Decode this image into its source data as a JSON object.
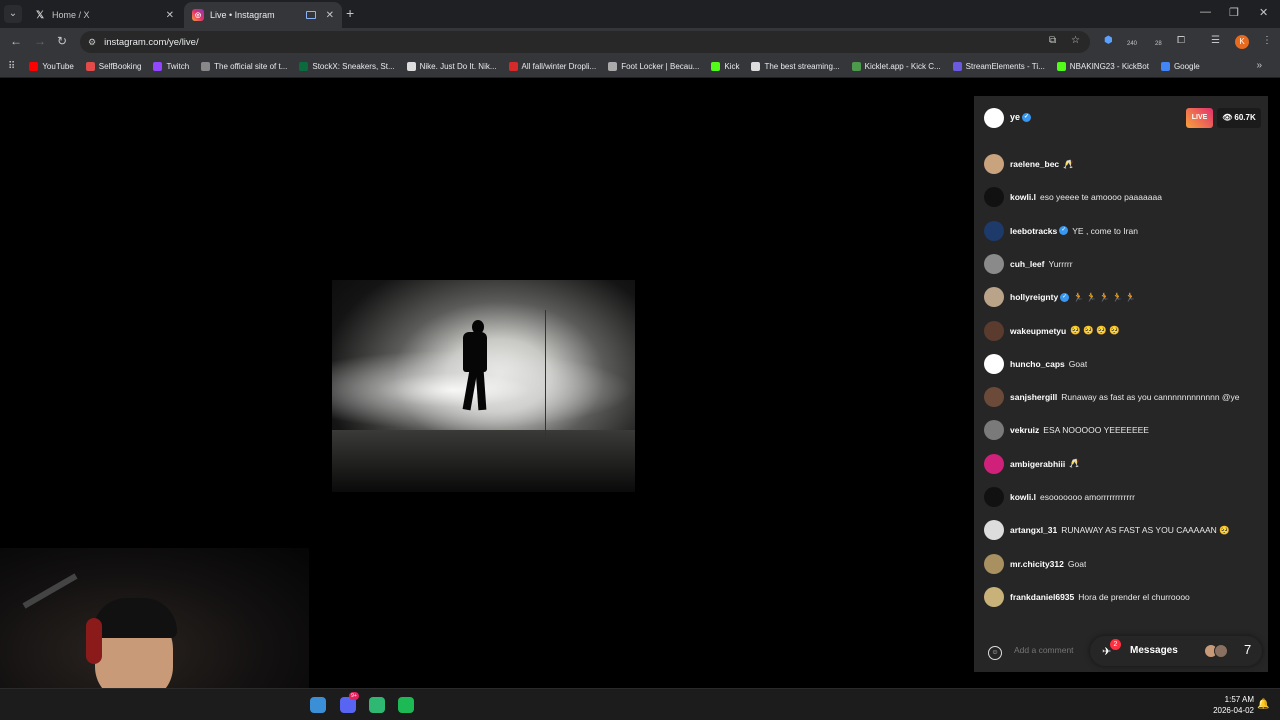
{
  "browser": {
    "tabs": [
      {
        "title": "Home / X",
        "icon": "x-logo-icon"
      },
      {
        "title": "Live • Instagram",
        "icon": "instagram-icon",
        "active": true
      }
    ],
    "url": "instagram.com/ye/live/",
    "extension_badges": [
      "240",
      "28"
    ],
    "profile_initial": "K",
    "bookmarks": [
      {
        "label": "YouTube",
        "color": "#ff0000"
      },
      {
        "label": "SelfBooking",
        "color": "#e34a4a"
      },
      {
        "label": "Twitch",
        "color": "#9146ff"
      },
      {
        "label": "The official site of t...",
        "color": "#888888"
      },
      {
        "label": "StockX: Sneakers, St...",
        "color": "#0c6b3d"
      },
      {
        "label": "Nike. Just Do It. Nik...",
        "color": "#dddddd"
      },
      {
        "label": "All fall/winter Dropli...",
        "color": "#d62a2a"
      },
      {
        "label": "Foot Locker | Becau...",
        "color": "#aaaaaa"
      },
      {
        "label": "Kick",
        "color": "#53fc18"
      },
      {
        "label": "The best streaming...",
        "color": "#dddddd"
      },
      {
        "label": "Kicklet.app - Kick C...",
        "color": "#4c9a4c"
      },
      {
        "label": "StreamElements - Ti...",
        "color": "#6a5ae0"
      },
      {
        "label": "NBAKING23 - KickBot",
        "color": "#53fc18"
      },
      {
        "label": "Google",
        "color": "#4285f4"
      }
    ]
  },
  "live": {
    "host": "ye",
    "live_label": "LIVE",
    "viewers": "60.7K",
    "comment_placeholder": "Add a comment",
    "messages_label": "Messages",
    "messages_badge": "2",
    "messages_trailing": "7",
    "comments": [
      {
        "user": "raelene_bec",
        "text": "🥂",
        "avatar_color": "#c9a27e"
      },
      {
        "user": "kowli.l",
        "text": "eso yeeee te amoooo paaaaaaa",
        "avatar_color": "#111111"
      },
      {
        "user": "leebotracks",
        "verified": true,
        "text": "YE , come to Iran",
        "avatar_color": "#1d3a6b"
      },
      {
        "user": "cuh_leef",
        "text": "Yurrrrr",
        "avatar_color": "#8a8a8a"
      },
      {
        "user": "hollyreignty",
        "verified": true,
        "text": "🏃 🏃 🏃 🏃 🏃",
        "avatar_color": "#b9a48a"
      },
      {
        "user": "wakeupmetyu",
        "text": "🥺 🥺 🥺 🥺",
        "avatar_color": "#5a3b2e"
      },
      {
        "user": "huncho_caps",
        "text": "Goat",
        "avatar_color": "#ffffff"
      },
      {
        "user": "sanjshergill",
        "text": "Runaway as fast as you cannnnnnnnnnnn @ye",
        "avatar_color": "#6b4a3a"
      },
      {
        "user": "vekruiz",
        "text": "ESA NOOOOO YEEEEEEE",
        "avatar_color": "#7a7a7a"
      },
      {
        "user": "ambigerabhiii",
        "text": "🥂",
        "avatar_color": "#d0217a"
      },
      {
        "user": "kowli.l",
        "text": "esooooooo amorrrrrrrrrrrr",
        "avatar_color": "#111111"
      },
      {
        "user": "artangxl_31",
        "text": "RUNAWAY AS FAST AS YOU CAAAAAN 🥺",
        "avatar_color": "#dddddd"
      },
      {
        "user": "mr.chicity312",
        "text": "Goat",
        "avatar_color": "#a89060"
      },
      {
        "user": "frankdaniel6935",
        "text": "Hora de prender el churroooo",
        "avatar_color": "#c8b27a"
      }
    ]
  },
  "taskbar": {
    "apps": [
      {
        "name": "file-explorer",
        "color": "#3a8fd6"
      },
      {
        "name": "discord",
        "color": "#5865f2",
        "badge": "9+"
      },
      {
        "name": "app-green",
        "color": "#2eb872"
      },
      {
        "name": "spotify",
        "color": "#1db954"
      }
    ],
    "time": "1:57 AM",
    "date": "2026-04-02"
  }
}
